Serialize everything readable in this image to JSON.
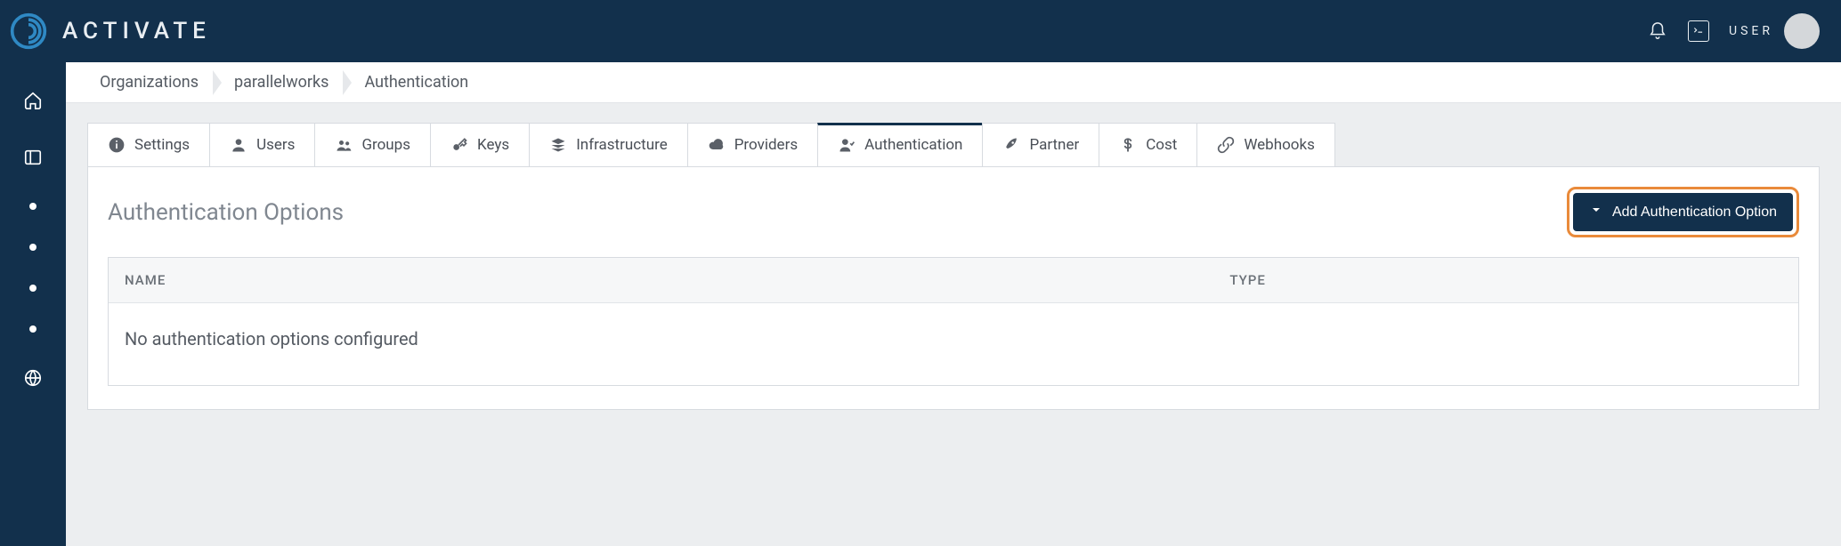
{
  "brand": {
    "name": "ACTIVATE"
  },
  "header": {
    "user_label": "USER"
  },
  "breadcrumbs": [
    "Organizations",
    "parallelworks",
    "Authentication"
  ],
  "tabs": [
    {
      "label": "Settings",
      "icon": "info-icon"
    },
    {
      "label": "Users",
      "icon": "user-icon"
    },
    {
      "label": "Groups",
      "icon": "group-icon"
    },
    {
      "label": "Keys",
      "icon": "key-icon"
    },
    {
      "label": "Infrastructure",
      "icon": "stack-icon"
    },
    {
      "label": "Providers",
      "icon": "cloud-icon"
    },
    {
      "label": "Authentication",
      "icon": "auth-icon",
      "active": true
    },
    {
      "label": "Partner",
      "icon": "rocket-icon"
    },
    {
      "label": "Cost",
      "icon": "dollar-icon"
    },
    {
      "label": "Webhooks",
      "icon": "link-icon"
    }
  ],
  "panel": {
    "title": "Authentication Options",
    "add_button": "Add Authentication Option",
    "columns": {
      "name": "NAME",
      "type": "TYPE"
    },
    "empty_message": "No authentication options configured"
  }
}
